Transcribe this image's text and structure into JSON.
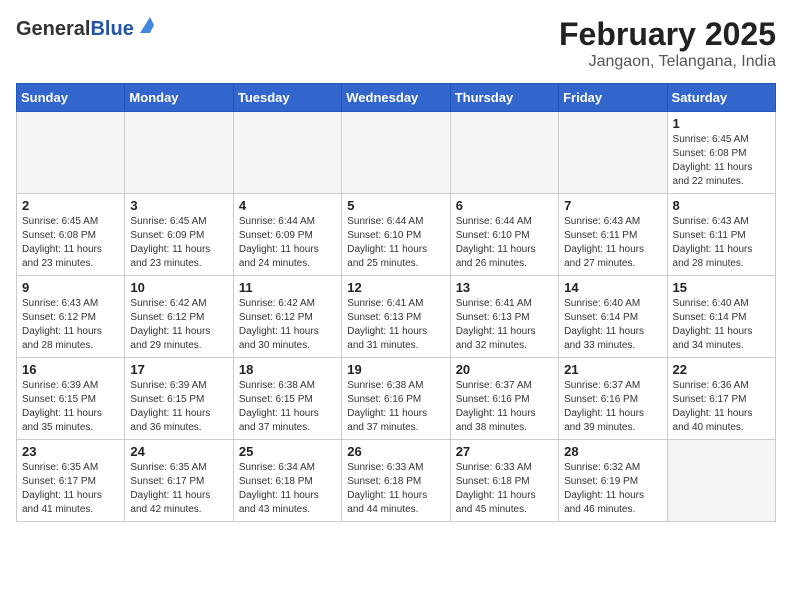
{
  "header": {
    "logo_general": "General",
    "logo_blue": "Blue",
    "month_title": "February 2025",
    "location": "Jangaon, Telangana, India"
  },
  "days_of_week": [
    "Sunday",
    "Monday",
    "Tuesday",
    "Wednesday",
    "Thursday",
    "Friday",
    "Saturday"
  ],
  "weeks": [
    [
      {
        "day": "",
        "info": ""
      },
      {
        "day": "",
        "info": ""
      },
      {
        "day": "",
        "info": ""
      },
      {
        "day": "",
        "info": ""
      },
      {
        "day": "",
        "info": ""
      },
      {
        "day": "",
        "info": ""
      },
      {
        "day": "1",
        "info": "Sunrise: 6:45 AM\nSunset: 6:08 PM\nDaylight: 11 hours and 22 minutes."
      }
    ],
    [
      {
        "day": "2",
        "info": "Sunrise: 6:45 AM\nSunset: 6:08 PM\nDaylight: 11 hours and 23 minutes."
      },
      {
        "day": "3",
        "info": "Sunrise: 6:45 AM\nSunset: 6:09 PM\nDaylight: 11 hours and 23 minutes."
      },
      {
        "day": "4",
        "info": "Sunrise: 6:44 AM\nSunset: 6:09 PM\nDaylight: 11 hours and 24 minutes."
      },
      {
        "day": "5",
        "info": "Sunrise: 6:44 AM\nSunset: 6:10 PM\nDaylight: 11 hours and 25 minutes."
      },
      {
        "day": "6",
        "info": "Sunrise: 6:44 AM\nSunset: 6:10 PM\nDaylight: 11 hours and 26 minutes."
      },
      {
        "day": "7",
        "info": "Sunrise: 6:43 AM\nSunset: 6:11 PM\nDaylight: 11 hours and 27 minutes."
      },
      {
        "day": "8",
        "info": "Sunrise: 6:43 AM\nSunset: 6:11 PM\nDaylight: 11 hours and 28 minutes."
      }
    ],
    [
      {
        "day": "9",
        "info": "Sunrise: 6:43 AM\nSunset: 6:12 PM\nDaylight: 11 hours and 28 minutes."
      },
      {
        "day": "10",
        "info": "Sunrise: 6:42 AM\nSunset: 6:12 PM\nDaylight: 11 hours and 29 minutes."
      },
      {
        "day": "11",
        "info": "Sunrise: 6:42 AM\nSunset: 6:12 PM\nDaylight: 11 hours and 30 minutes."
      },
      {
        "day": "12",
        "info": "Sunrise: 6:41 AM\nSunset: 6:13 PM\nDaylight: 11 hours and 31 minutes."
      },
      {
        "day": "13",
        "info": "Sunrise: 6:41 AM\nSunset: 6:13 PM\nDaylight: 11 hours and 32 minutes."
      },
      {
        "day": "14",
        "info": "Sunrise: 6:40 AM\nSunset: 6:14 PM\nDaylight: 11 hours and 33 minutes."
      },
      {
        "day": "15",
        "info": "Sunrise: 6:40 AM\nSunset: 6:14 PM\nDaylight: 11 hours and 34 minutes."
      }
    ],
    [
      {
        "day": "16",
        "info": "Sunrise: 6:39 AM\nSunset: 6:15 PM\nDaylight: 11 hours and 35 minutes."
      },
      {
        "day": "17",
        "info": "Sunrise: 6:39 AM\nSunset: 6:15 PM\nDaylight: 11 hours and 36 minutes."
      },
      {
        "day": "18",
        "info": "Sunrise: 6:38 AM\nSunset: 6:15 PM\nDaylight: 11 hours and 37 minutes."
      },
      {
        "day": "19",
        "info": "Sunrise: 6:38 AM\nSunset: 6:16 PM\nDaylight: 11 hours and 37 minutes."
      },
      {
        "day": "20",
        "info": "Sunrise: 6:37 AM\nSunset: 6:16 PM\nDaylight: 11 hours and 38 minutes."
      },
      {
        "day": "21",
        "info": "Sunrise: 6:37 AM\nSunset: 6:16 PM\nDaylight: 11 hours and 39 minutes."
      },
      {
        "day": "22",
        "info": "Sunrise: 6:36 AM\nSunset: 6:17 PM\nDaylight: 11 hours and 40 minutes."
      }
    ],
    [
      {
        "day": "23",
        "info": "Sunrise: 6:35 AM\nSunset: 6:17 PM\nDaylight: 11 hours and 41 minutes."
      },
      {
        "day": "24",
        "info": "Sunrise: 6:35 AM\nSunset: 6:17 PM\nDaylight: 11 hours and 42 minutes."
      },
      {
        "day": "25",
        "info": "Sunrise: 6:34 AM\nSunset: 6:18 PM\nDaylight: 11 hours and 43 minutes."
      },
      {
        "day": "26",
        "info": "Sunrise: 6:33 AM\nSunset: 6:18 PM\nDaylight: 11 hours and 44 minutes."
      },
      {
        "day": "27",
        "info": "Sunrise: 6:33 AM\nSunset: 6:18 PM\nDaylight: 11 hours and 45 minutes."
      },
      {
        "day": "28",
        "info": "Sunrise: 6:32 AM\nSunset: 6:19 PM\nDaylight: 11 hours and 46 minutes."
      },
      {
        "day": "",
        "info": ""
      }
    ]
  ]
}
